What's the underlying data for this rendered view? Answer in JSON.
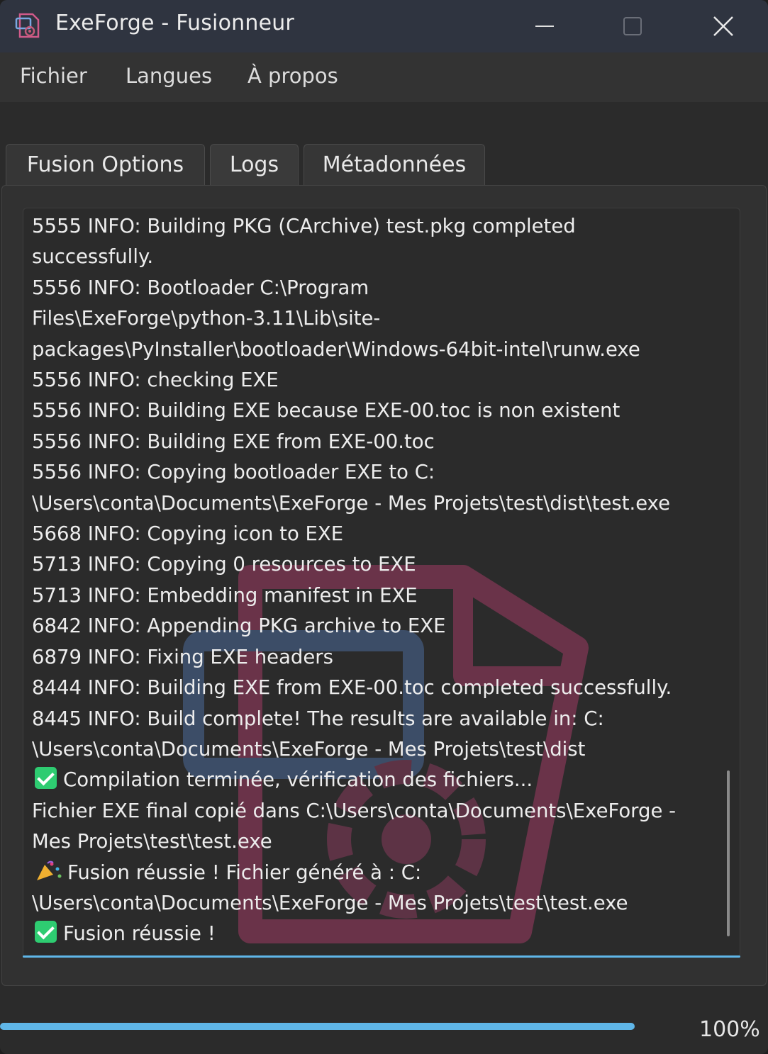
{
  "window": {
    "title": "ExeForge - Fusionneur",
    "icon": "app-icon",
    "controls": {
      "minimize": "minimize-icon",
      "maximize": "maximize-icon",
      "close": "close-icon"
    }
  },
  "menu": {
    "items": [
      {
        "label": "Fichier"
      },
      {
        "label": "Langues"
      },
      {
        "label": "À propos"
      }
    ]
  },
  "tabs": [
    {
      "label": "Fusion  Options",
      "active": false
    },
    {
      "label": "Logs",
      "active": true
    },
    {
      "label": "Métadonnées",
      "active": false
    }
  ],
  "log": {
    "lines": [
      {
        "text": "5555 INFO: Building PKG (CArchive) test.pkg completed successfully."
      },
      {
        "text": "5556 INFO: Bootloader C:\\Program Files\\ExeForge\\python-3.11\\Lib\\site-packages\\PyInstaller\\bootloader\\Windows-64bit-intel\\runw.exe"
      },
      {
        "text": "5556 INFO: checking EXE"
      },
      {
        "text": "5556 INFO: Building EXE because EXE-00.toc is non existent"
      },
      {
        "text": "5556 INFO: Building EXE from EXE-00.toc"
      },
      {
        "text": "5556 INFO: Copying bootloader EXE to C:\\Users\\conta\\Documents\\ExeForge - Mes Projets\\test\\dist\\test.exe"
      },
      {
        "text": "5668 INFO: Copying icon to EXE"
      },
      {
        "text": "5713 INFO: Copying 0 resources to EXE"
      },
      {
        "text": "5713 INFO: Embedding manifest in EXE"
      },
      {
        "text": "6842 INFO: Appending PKG archive to EXE"
      },
      {
        "text": "6879 INFO: Fixing EXE headers"
      },
      {
        "text": "8444 INFO: Building EXE from EXE-00.toc completed successfully."
      },
      {
        "text": "8445 INFO: Build complete! The results are available in: C:\\Users\\conta\\Documents\\ExeForge - Mes Projets\\test\\dist"
      },
      {
        "text": "Compilation terminée, vérification des fichiers...",
        "icon": "check-mark-icon"
      },
      {
        "text": "Fichier EXE final copié dans C:\\Users\\conta\\Documents\\ExeForge - Mes Projets\\test\\test.exe"
      },
      {
        "text": "Fusion réussie ! Fichier généré à : C:\\Users\\conta\\Documents\\ExeForge - Mes Projets\\test\\test.exe",
        "icon": "party-popper-icon"
      },
      {
        "text": "Fusion réussie !",
        "icon": "check-mark-icon"
      }
    ],
    "wrapped_display": [
      "5555 INFO: Building PKG (CArchive) test.pkg completed",
      "successfully.",
      "5556 INFO: Bootloader C:\\Program",
      "Files\\ExeForge\\python-3.11\\Lib\\site-",
      "packages\\PyInstaller\\bootloader\\Windows-64bit-intel\\runw.exe",
      "5556 INFO: checking EXE",
      "5556 INFO: Building EXE because EXE-00.toc is non existent",
      "5556 INFO: Building EXE from EXE-00.toc",
      "5556 INFO: Copying bootloader EXE to C:",
      "\\Users\\conta\\Documents\\ExeForge - Mes Projets\\test\\dist\\test.exe",
      "5668 INFO: Copying icon to EXE",
      "5713 INFO: Copying 0 resources to EXE",
      "5713 INFO: Embedding manifest in EXE",
      "6842 INFO: Appending PKG archive to EXE",
      "6879 INFO: Fixing EXE headers",
      "8444 INFO: Building EXE from EXE-00.toc completed successfully.",
      "8445 INFO: Build complete! The results are available in: C:",
      "\\Users\\conta\\Documents\\ExeForge - Mes Projets\\test\\dist",
      "Compilation terminée, vérification des fichiers...",
      "Fichier EXE final copié dans C:\\Users\\conta\\Documents\\ExeForge -",
      "Mes Projets\\test\\test.exe",
      "Fusion réussie ! Fichier généré à : C:",
      "\\Users\\conta\\Documents\\ExeForge - Mes Projets\\test\\test.exe",
      "Fusion réussie !"
    ],
    "line_icons": {
      "18": "check-mark-icon",
      "21": "party-popper-icon",
      "23": "check-mark-icon"
    }
  },
  "progress": {
    "value": 1.0,
    "label": "100%",
    "color": "#5fb6e8"
  },
  "colors": {
    "accent": "#5fb6e8",
    "success": "#2ecc71",
    "titlebar": "#2f3440"
  }
}
